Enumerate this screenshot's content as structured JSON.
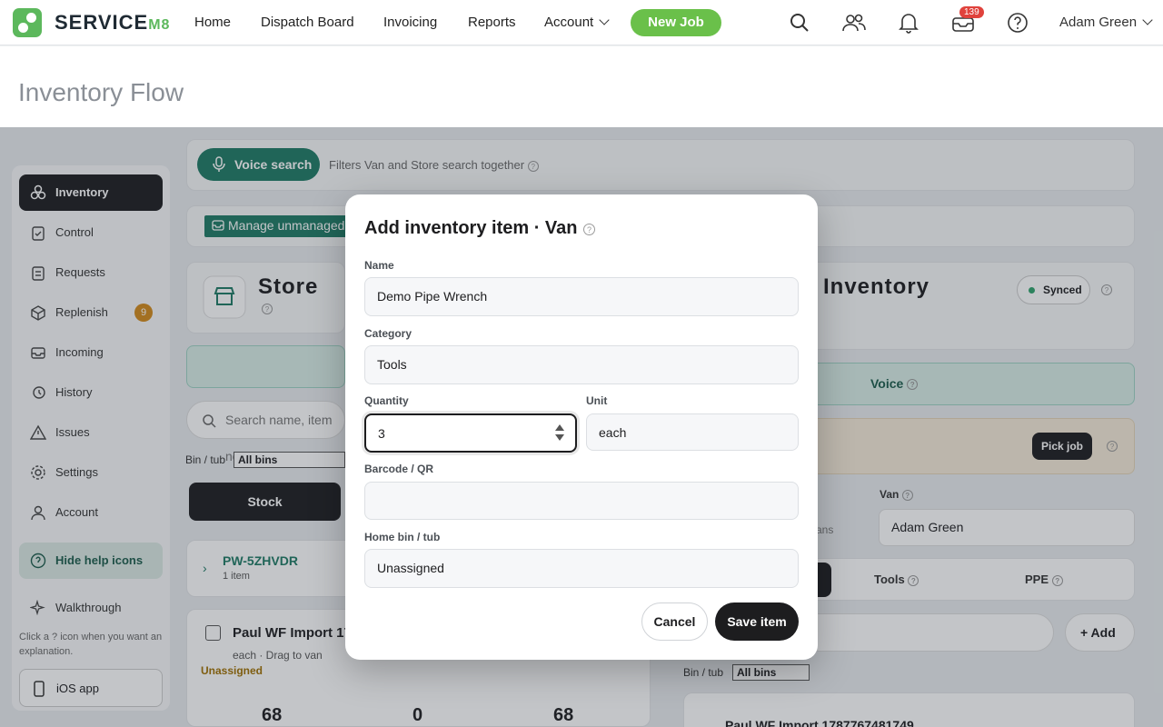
{
  "nav": {
    "brand_main": "SERVICE",
    "brand_suffix": "M8",
    "items": [
      "Home",
      "Dispatch Board",
      "Invoicing",
      "Reports",
      "Account"
    ],
    "new_job": "New Job",
    "inbox_count": "139",
    "user": "Adam Green"
  },
  "page": {
    "title": "Inventory Flow"
  },
  "sidebar": {
    "items": [
      "Inventory",
      "Control",
      "Requests",
      "Replenish",
      "Incoming",
      "History",
      "Issues",
      "Settings",
      "Account"
    ],
    "replenish_badge": "9",
    "help_toggle": "Hide help icons",
    "walkthrough": "Walkthrough",
    "note": "Click a ? icon when you want an explanation.",
    "ios_app": "iOS app"
  },
  "background": {
    "voice_search": "Voice search",
    "voice_hint": "Filters Van and Store search together",
    "manage_unmanaged": "Manage unmanaged",
    "store_heading": "Store",
    "inventory_heading": "Inventory",
    "synced": "Synced",
    "voice": "Voice",
    "search_placeholder": "Search name, item no",
    "pick_job": "Pick job",
    "bin_tub_label": "Bin / tub",
    "all_bins": "All bins",
    "stock": "Stock",
    "van_label": "Van",
    "van_value": "Adam Green",
    "vans_fragment": "ans",
    "tools": "Tools",
    "ppe": "PPE",
    "add": "Add",
    "group_code": "PW-5ZHVDR",
    "group_count": "1 item",
    "item_name": "Paul WF Import 17",
    "item_sub": "each · Drag to van",
    "item_status": "Unassigned",
    "right_item_name": "Paul WF Import 1787767481749",
    "stat1": "68",
    "stat2": "0",
    "stat3": "68"
  },
  "modal": {
    "title": "Add inventory item · Van",
    "name_label": "Name",
    "name_value": "Demo Pipe Wrench",
    "category_label": "Category",
    "category_value": "Tools",
    "quantity_label": "Quantity",
    "quantity_value": "3",
    "unit_label": "Unit",
    "unit_value": "each",
    "barcode_label": "Barcode / QR",
    "barcode_value": "",
    "home_bin_label": "Home bin / tub",
    "home_bin_value": "Unassigned",
    "cancel": "Cancel",
    "save": "Save item"
  },
  "colors": {
    "brand_green": "#5cb85c",
    "new_job_green": "#6ac04a",
    "teal": "#1e7a64",
    "badge_red": "#e0423c",
    "dark": "#1d1d1f"
  }
}
